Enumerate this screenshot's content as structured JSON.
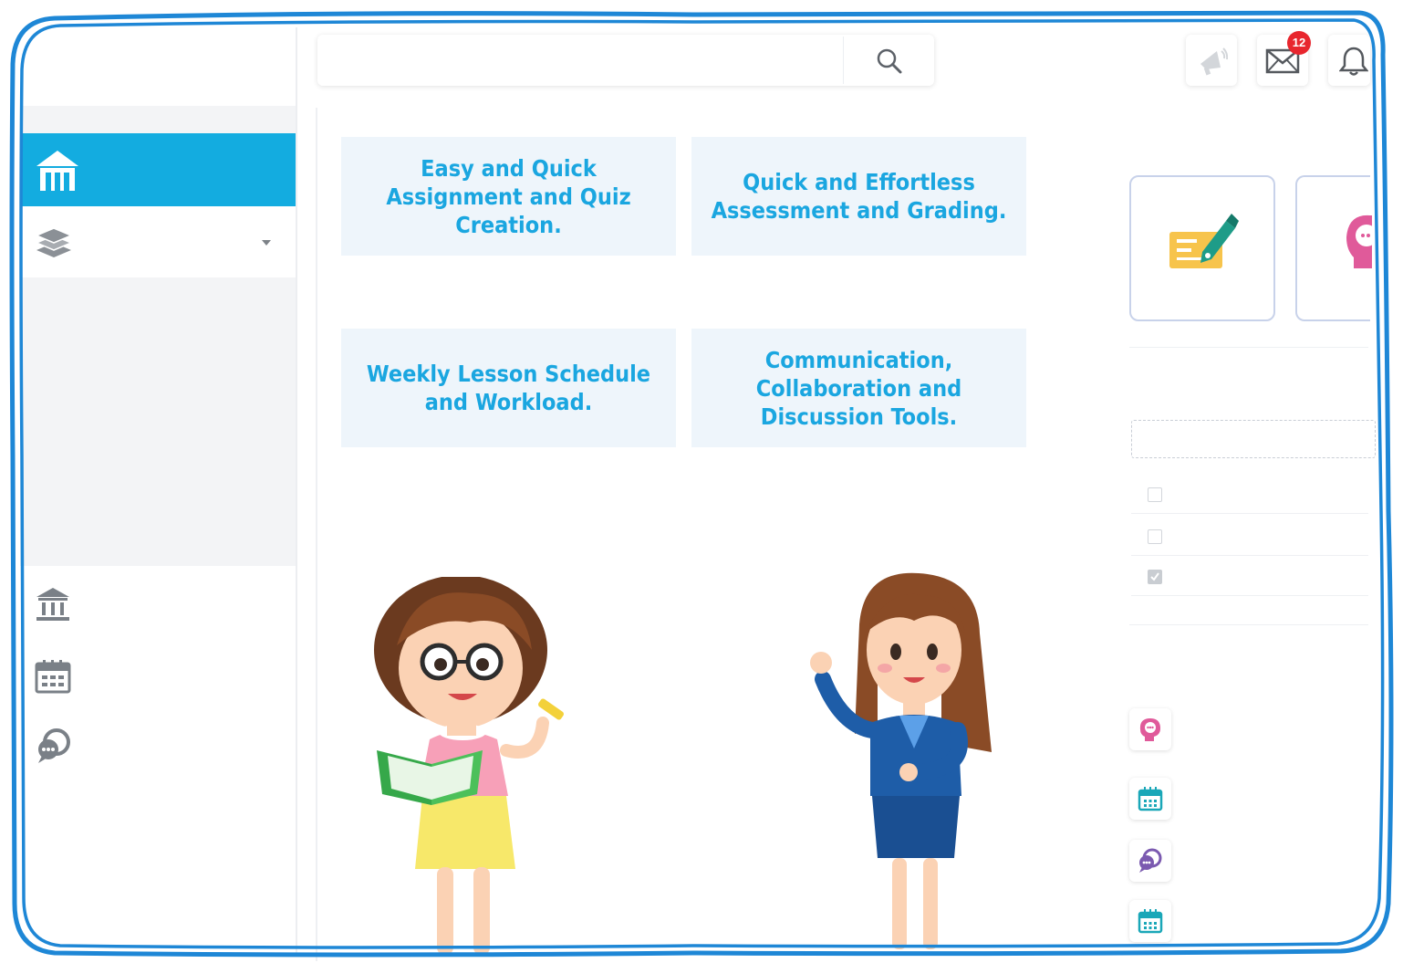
{
  "header": {
    "search_placeholder": "",
    "mail_badge": "12"
  },
  "features": [
    {
      "text": "Easy and Quick Assignment and Quiz Creation."
    },
    {
      "text": "Quick and Effortless Assessment and Grading."
    },
    {
      "text": "Weekly Lesson Schedule and Workload."
    },
    {
      "text": "Communication, Collaboration and Discussion Tools."
    }
  ],
  "colors": {
    "accent": "#13ace0",
    "feature_text": "#1aa6e0",
    "feature_bg": "#eef5fb",
    "frame": "#1e87d6",
    "badge": "#e8262e",
    "card_border": "#c8d2ea"
  },
  "icons": {
    "sidebar": [
      "home-icon",
      "layers-icon",
      "chevron-down-icon",
      "institution-icon",
      "calendar-icon",
      "chat-bubbles-icon"
    ],
    "topbar": [
      "search-icon",
      "megaphone-icon",
      "mail-icon",
      "bell-icon"
    ],
    "cards": [
      "assignment-pen-icon",
      "head-chat-icon"
    ],
    "right_list": [
      "head-chat-icon",
      "calendar-icon",
      "chat-bubbles-icon",
      "calendar-icon"
    ]
  }
}
